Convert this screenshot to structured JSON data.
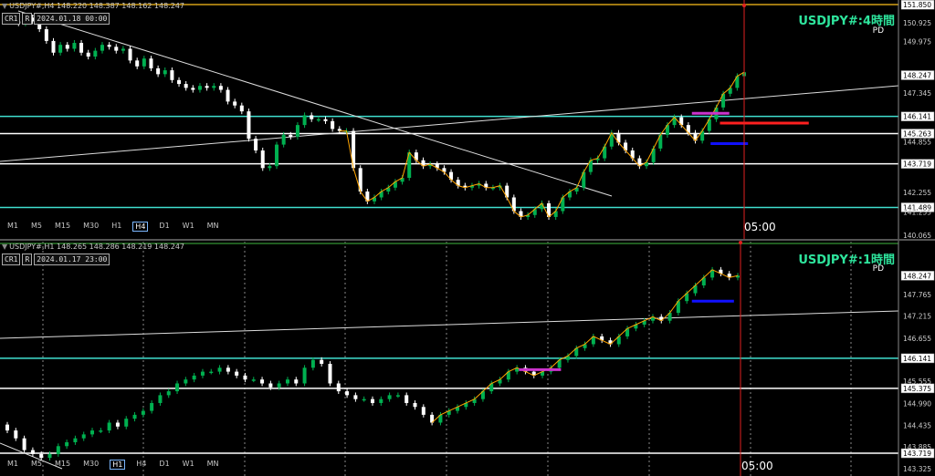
{
  "colors": {
    "bull": "#00b050",
    "bear": "#ffffff",
    "zigzag": "#ffa500",
    "cyan": "#40e0d0",
    "magenta": "#cc33cc",
    "red": "#ff2020",
    "blue": "#1010ff",
    "symbol": "#2ee59d"
  },
  "timeframes": [
    "M1",
    "M5",
    "M15",
    "M30",
    "H1",
    "H4",
    "D1",
    "W1",
    "MN"
  ],
  "time_label": "05:00",
  "panels": [
    {
      "header": "USDJPY#,H4  148.220 148.387 148.162 148.247",
      "buttons": {
        "cr1": "CR1",
        "r": "R",
        "date": "2024.01.18 00:00"
      },
      "symbol": "USDJPY#:4時間",
      "pd": "PD",
      "active_tf": "H4",
      "axis_labels": [
        "151.850",
        "150.925",
        "149.975",
        "148.247",
        "147.345",
        "146.141",
        "145.263",
        "144.855",
        "143.719",
        "142.255",
        "141.489",
        "141.255",
        "140.065"
      ],
      "boxed_labels": [
        "151.850",
        "148.247",
        "146.141",
        "145.263",
        "143.719",
        "141.489"
      ]
    },
    {
      "header": "USDJPY#,H1  148.265 148.286 148.219 148.247",
      "buttons": {
        "cr1": "CR1",
        "r": "R",
        "date": "2024.01.17 23:00"
      },
      "symbol": "USDJPY#:1時間",
      "pd": "PD",
      "active_tf": "H1",
      "axis_labels": [
        "148.247",
        "147.765",
        "147.215",
        "146.655",
        "146.141",
        "145.555",
        "145.375",
        "144.990",
        "144.435",
        "143.885",
        "143.719",
        "143.325"
      ],
      "boxed_labels": [
        "148.247",
        "146.141",
        "145.375",
        "143.719"
      ]
    }
  ],
  "chart_data": [
    {
      "type": "candlestick",
      "title": "USDJPY#:4時間",
      "timeframe": "H4",
      "ohlc_last": {
        "open": 148.22,
        "high": 148.387,
        "low": 148.162,
        "close": 148.247
      },
      "y_range": [
        140.065,
        152.0
      ],
      "close_path": [
        151.1,
        151.0,
        150.9,
        151.2,
        151.0,
        150.6,
        150.0,
        149.4,
        149.8,
        149.6,
        149.9,
        149.4,
        149.2,
        149.5,
        149.8,
        149.7,
        149.5,
        149.6,
        149.0,
        148.7,
        149.1,
        148.6,
        148.3,
        148.5,
        148.0,
        147.8,
        147.6,
        147.5,
        147.7,
        147.6,
        147.7,
        147.5,
        146.9,
        146.7,
        146.4,
        145.0,
        144.4,
        143.5,
        143.6,
        144.7,
        145.2,
        145.1,
        145.7,
        146.2,
        146.0,
        146.0,
        145.9,
        145.5,
        145.4,
        145.4,
        143.5,
        142.3,
        141.8,
        142.0,
        142.3,
        142.5,
        142.8,
        143.0,
        144.3,
        143.9,
        143.6,
        143.7,
        143.5,
        143.3,
        142.9,
        142.6,
        142.5,
        142.6,
        142.7,
        142.5,
        142.5,
        142.6,
        142.0,
        141.3,
        141.0,
        141.1,
        141.4,
        141.7,
        141.0,
        141.3,
        142.0,
        142.3,
        142.5,
        143.3,
        143.9,
        144.0,
        144.6,
        145.3,
        144.8,
        144.4,
        144.0,
        143.6,
        143.8,
        144.5,
        145.2,
        145.7,
        146.1,
        145.7,
        145.3,
        144.9,
        145.4,
        146.0,
        146.6,
        147.3,
        147.6,
        148.2,
        148.4
      ],
      "horizontal_levels": [
        {
          "price": 146.141,
          "color": "cyan"
        },
        {
          "price": 145.263,
          "color": "white"
        },
        {
          "price": 143.719,
          "color": "white"
        },
        {
          "price": 141.489,
          "color": "cyan"
        }
      ],
      "zones": [
        {
          "price": 146.3,
          "from": 0.74,
          "to": 0.78,
          "color": "magenta"
        },
        {
          "price": 145.8,
          "from": 0.77,
          "to": 0.865,
          "color": "red"
        },
        {
          "price": 144.75,
          "from": 0.76,
          "to": 0.8,
          "color": "blue"
        }
      ]
    },
    {
      "type": "candlestick",
      "title": "USDJPY#:1時間",
      "timeframe": "H1",
      "ohlc_last": {
        "open": 148.265,
        "high": 148.286,
        "low": 148.219,
        "close": 148.247
      },
      "y_range": [
        143.325,
        149.0
      ],
      "close_path": [
        144.3,
        144.1,
        143.8,
        143.7,
        143.6,
        143.7,
        143.9,
        144.0,
        144.1,
        144.2,
        144.3,
        144.3,
        144.5,
        144.4,
        144.6,
        144.7,
        144.8,
        145.0,
        145.2,
        145.3,
        145.5,
        145.6,
        145.7,
        145.8,
        145.8,
        145.9,
        145.8,
        145.7,
        145.6,
        145.6,
        145.5,
        145.4,
        145.5,
        145.6,
        145.5,
        145.9,
        146.1,
        146.0,
        145.5,
        145.3,
        145.2,
        145.1,
        145.1,
        145.0,
        145.1,
        145.2,
        145.2,
        145.0,
        144.9,
        144.7,
        144.5,
        144.7,
        144.8,
        144.9,
        145.0,
        145.1,
        145.3,
        145.5,
        145.6,
        145.8,
        145.9,
        145.8,
        145.7,
        145.8,
        145.9,
        146.1,
        146.2,
        146.4,
        146.5,
        146.7,
        146.6,
        146.5,
        146.7,
        146.9,
        147.0,
        147.1,
        147.2,
        147.1,
        147.3,
        147.6,
        147.8,
        148.0,
        148.2,
        148.4,
        148.3,
        148.2,
        148.25
      ],
      "horizontal_levels": [
        {
          "price": 146.141,
          "color": "cyan"
        },
        {
          "price": 145.375,
          "color": "white"
        },
        {
          "price": 143.719,
          "color": "white"
        }
      ],
      "zones": [
        {
          "price": 145.85,
          "from": 0.555,
          "to": 0.6,
          "color": "magenta"
        },
        {
          "price": 147.6,
          "from": 0.74,
          "to": 0.785,
          "color": "blue"
        }
      ]
    }
  ]
}
